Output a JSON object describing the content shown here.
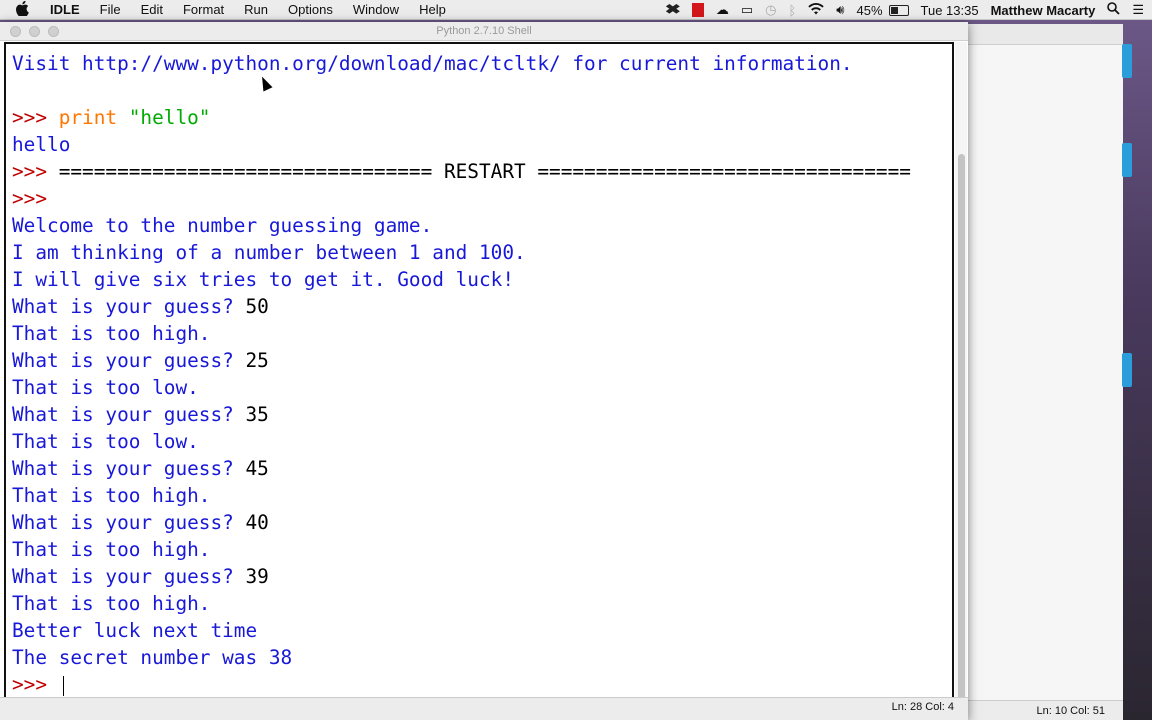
{
  "menubar": {
    "apple": "",
    "app_name": "IDLE",
    "menus": [
      "File",
      "Edit",
      "Format",
      "Run",
      "Options",
      "Window",
      "Help"
    ],
    "battery": "45%",
    "clock": "Tue 13:35",
    "user": "Matthew Macarty"
  },
  "window": {
    "title": "Python 2.7.10 Shell",
    "status": "Ln: 28 Col: 4"
  },
  "background_window": {
    "status": "Ln: 10 Col: 51"
  },
  "shell": {
    "lines": [
      {
        "prompt": "",
        "text": "Visit http://www.python.org/download/mac/tcltk/ for current information.",
        "color": "blue"
      },
      {
        "prompt": "",
        "text": "",
        "color": "black"
      },
      {
        "prompt": ">>> ",
        "text": "print",
        "extra": " \"hello\"",
        "color": "orange"
      },
      {
        "prompt": "",
        "text": "hello",
        "color": "blue"
      },
      {
        "prompt": ">>> ",
        "text": "================================ RESTART ================================",
        "color": "black"
      },
      {
        "prompt": ">>> ",
        "text": "",
        "color": "black"
      },
      {
        "prompt": "",
        "text": "Welcome to the number guessing game.",
        "color": "blue"
      },
      {
        "prompt": "",
        "text": "I am thinking of a number between 1 and 100.",
        "color": "blue"
      },
      {
        "prompt": "",
        "text": "I will give six tries to get it. Good luck!",
        "color": "blue"
      },
      {
        "prompt": "",
        "text": "What is your guess? ",
        "input": "50",
        "color": "blue"
      },
      {
        "prompt": "",
        "text": "That is too high.",
        "color": "blue"
      },
      {
        "prompt": "",
        "text": "What is your guess? ",
        "input": "25",
        "color": "blue"
      },
      {
        "prompt": "",
        "text": "That is too low.",
        "color": "blue"
      },
      {
        "prompt": "",
        "text": "What is your guess? ",
        "input": "35",
        "color": "blue"
      },
      {
        "prompt": "",
        "text": "That is too low.",
        "color": "blue"
      },
      {
        "prompt": "",
        "text": "What is your guess? ",
        "input": "45",
        "color": "blue"
      },
      {
        "prompt": "",
        "text": "That is too high.",
        "color": "blue"
      },
      {
        "prompt": "",
        "text": "What is your guess? ",
        "input": "40",
        "color": "blue"
      },
      {
        "prompt": "",
        "text": "That is too high.",
        "color": "blue"
      },
      {
        "prompt": "",
        "text": "What is your guess? ",
        "input": "39",
        "color": "blue"
      },
      {
        "prompt": "",
        "text": "That is too high.",
        "color": "blue"
      },
      {
        "prompt": "",
        "text": "Better luck next time",
        "color": "blue"
      },
      {
        "prompt": "",
        "text": "The secret number was 38",
        "color": "blue"
      },
      {
        "prompt": ">>> ",
        "text": "",
        "color": "black",
        "cursor": true
      }
    ]
  },
  "colors": {
    "output": "#1818d8",
    "prompt": "#c00000",
    "keyword": "#ff7700",
    "string": "#00aa00"
  }
}
